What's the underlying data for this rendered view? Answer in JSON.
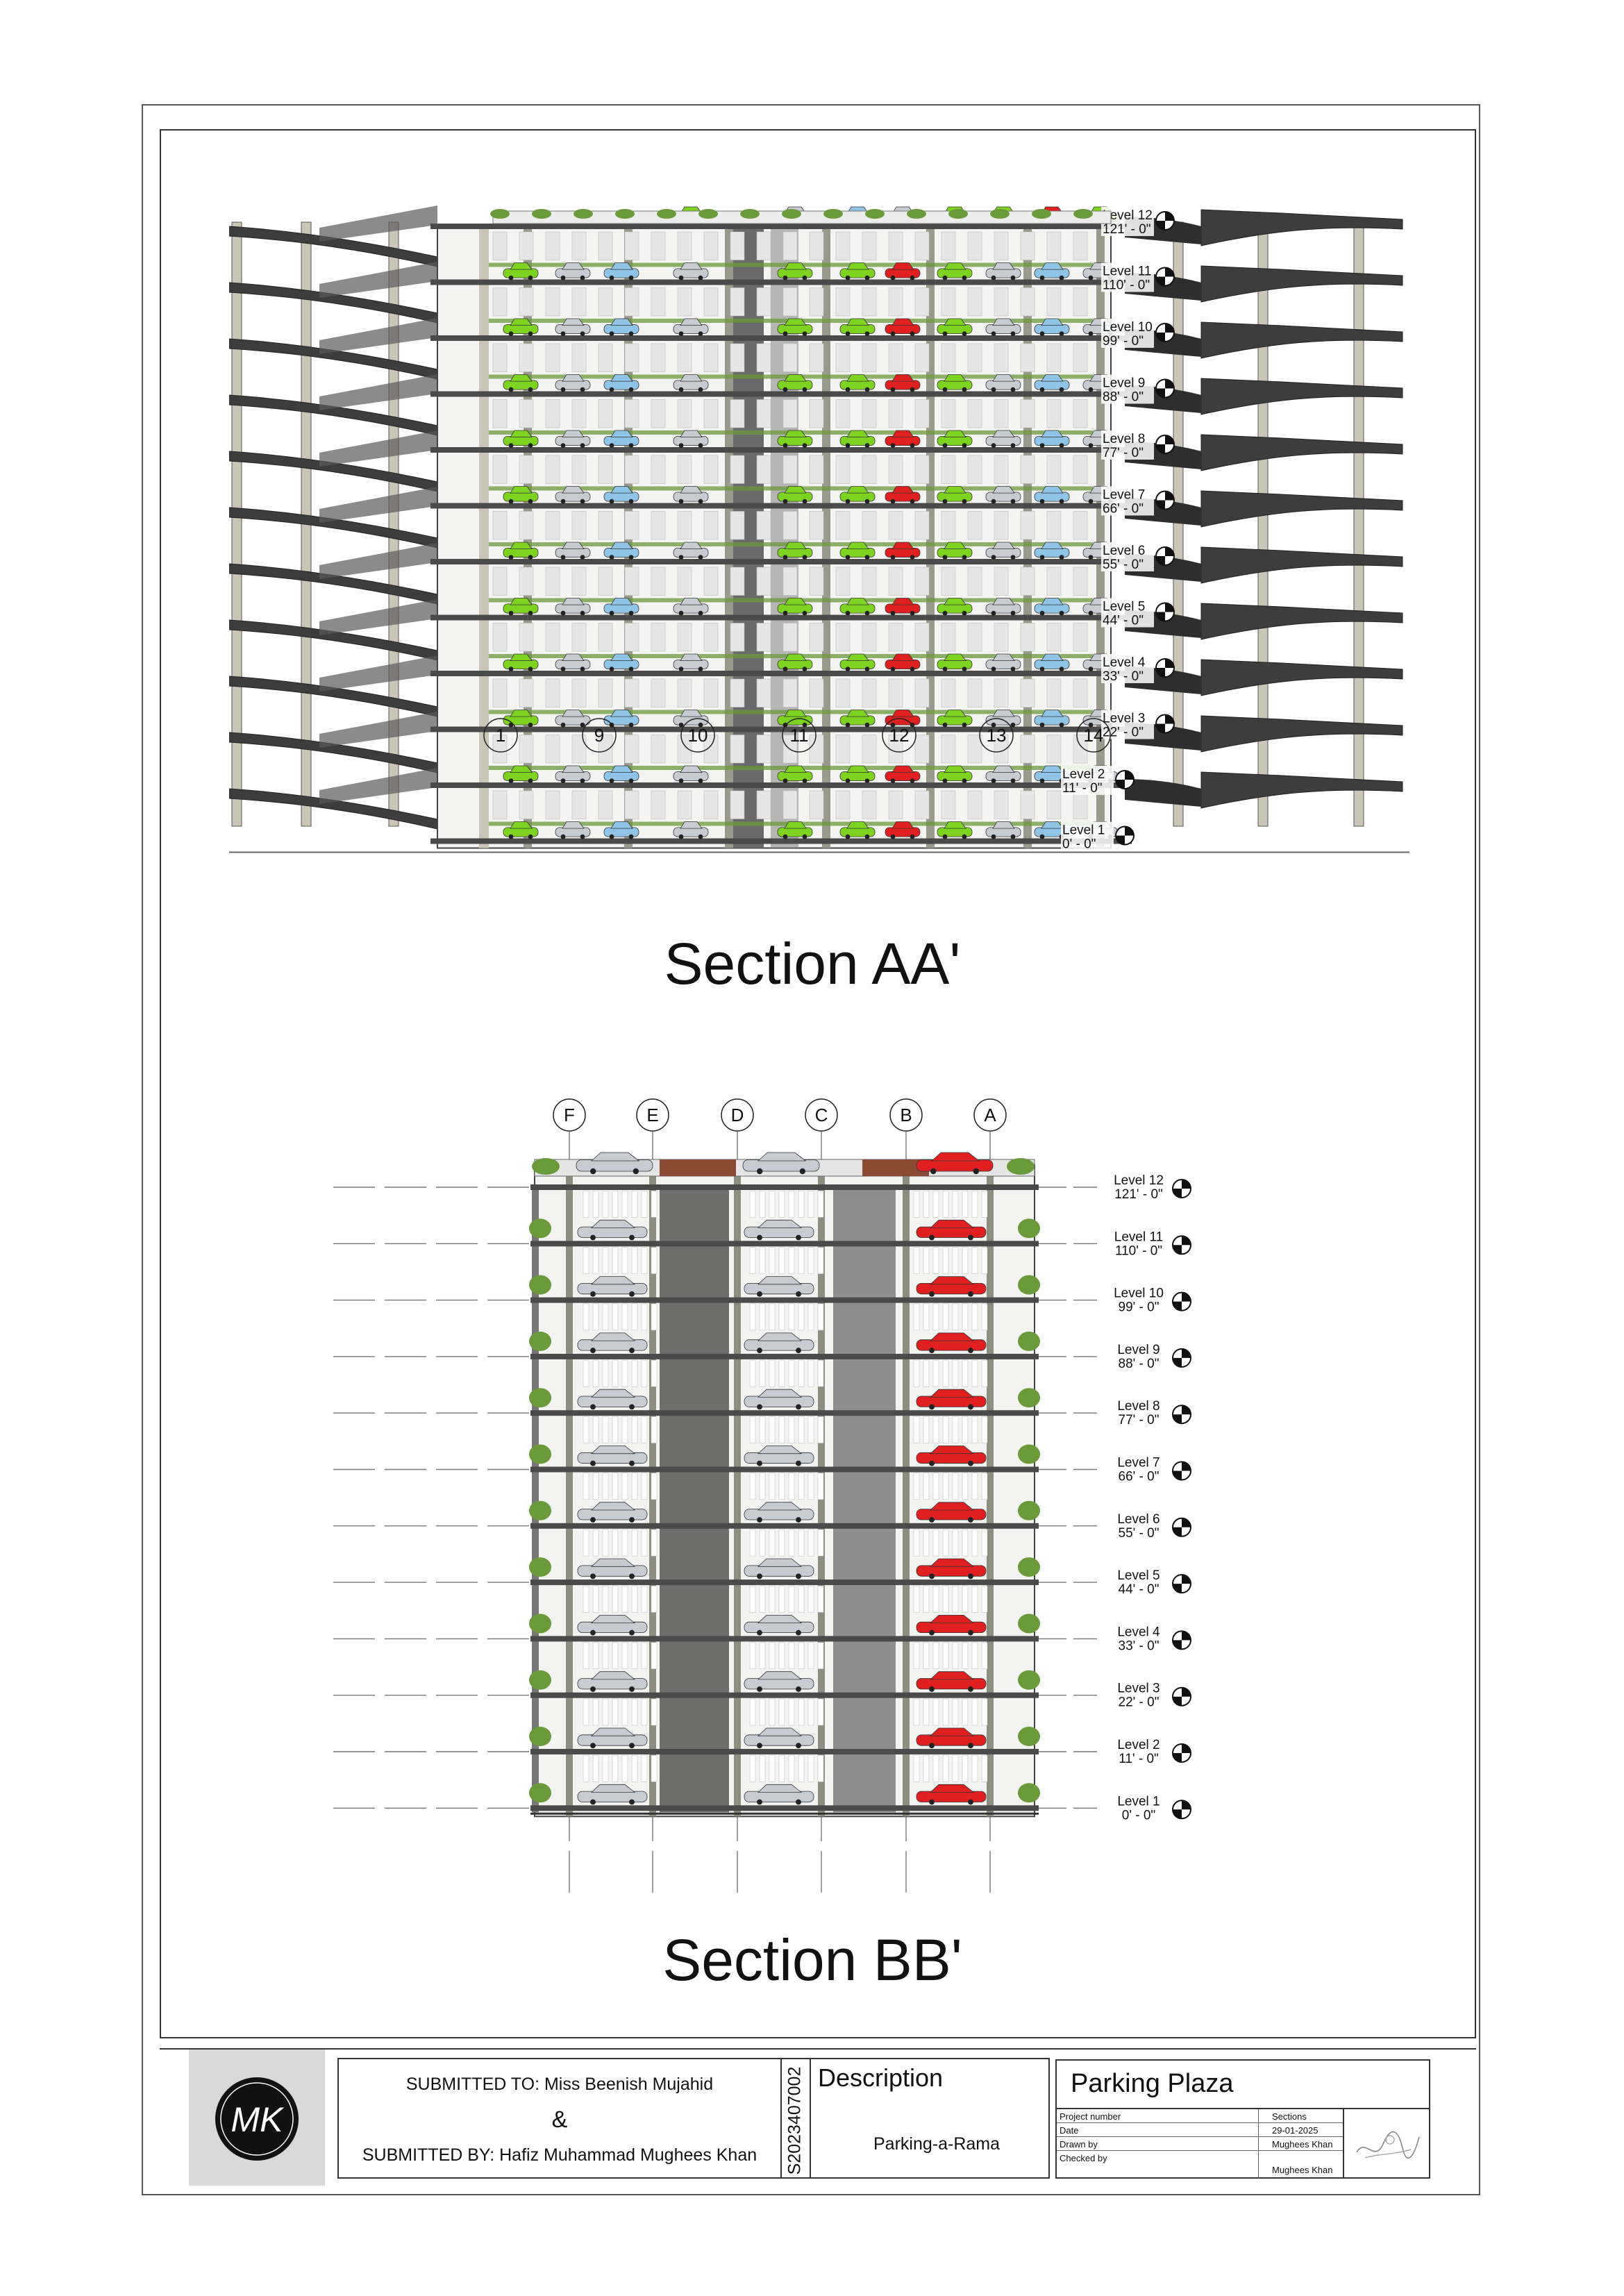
{
  "section_aa": {
    "title": "Section AA'",
    "grid_labels": [
      "1",
      "9",
      "10",
      "11",
      "12",
      "13",
      "14"
    ],
    "levels": [
      {
        "name": "Level 12",
        "elev": "121' - 0\""
      },
      {
        "name": "Level 11",
        "elev": "110' - 0\""
      },
      {
        "name": "Level 10",
        "elev": "99' - 0\""
      },
      {
        "name": "Level 9",
        "elev": "88' - 0\""
      },
      {
        "name": "Level 8",
        "elev": "77' - 0\""
      },
      {
        "name": "Level 7",
        "elev": "66' - 0\""
      },
      {
        "name": "Level 6",
        "elev": "55' - 0\""
      },
      {
        "name": "Level 5",
        "elev": "44' - 0\""
      },
      {
        "name": "Level 4",
        "elev": "33' - 0\""
      },
      {
        "name": "Level 3",
        "elev": "22' - 0\""
      },
      {
        "name": "Level 2",
        "elev": "11' - 0\""
      },
      {
        "name": "Level 1",
        "elev": "0' - 0\""
      }
    ]
  },
  "section_bb": {
    "title": "Section BB'",
    "grid_labels": [
      "F",
      "E",
      "D",
      "C",
      "B",
      "A"
    ],
    "levels": [
      {
        "name": "Level 12",
        "elev": "121' - 0\""
      },
      {
        "name": "Level 11",
        "elev": "110' - 0\""
      },
      {
        "name": "Level 10",
        "elev": "99' - 0\""
      },
      {
        "name": "Level 9",
        "elev": "88' - 0\""
      },
      {
        "name": "Level 8",
        "elev": "77' - 0\""
      },
      {
        "name": "Level 7",
        "elev": "66' - 0\""
      },
      {
        "name": "Level 6",
        "elev": "55' - 0\""
      },
      {
        "name": "Level 5",
        "elev": "44' - 0\""
      },
      {
        "name": "Level 4",
        "elev": "33' - 0\""
      },
      {
        "name": "Level 3",
        "elev": "22' - 0\""
      },
      {
        "name": "Level 2",
        "elev": "11' - 0\""
      },
      {
        "name": "Level 1",
        "elev": "0' - 0\""
      }
    ]
  },
  "title_block": {
    "logo_text": "MK",
    "submitted_to": "SUBMITTED TO: Miss Beenish Mujahid",
    "ampersand": "&",
    "submitted_by": "SUBMITTED BY: Hafiz Muhammad Mughees Khan",
    "student_id": "S2023407002",
    "description_heading": "Description",
    "description_value": "Parking-a-Rama",
    "project_name": "Parking Plaza",
    "rows": [
      {
        "label": "Project number",
        "value": "Sections"
      },
      {
        "label": "Date",
        "value": "29-01-2025"
      },
      {
        "label": "Drawn by",
        "value": "Mughees Khan"
      },
      {
        "label": "Checked by",
        "value": "Mughees Khan"
      }
    ]
  },
  "colors": {
    "car_green": "#7ed321",
    "car_red": "#e02020",
    "car_silver": "#c8ccd2",
    "car_blue": "#8fc4e6",
    "slab": "#4a4a4a",
    "column": "#c9c6b8",
    "planter": "#6b9a3a"
  }
}
